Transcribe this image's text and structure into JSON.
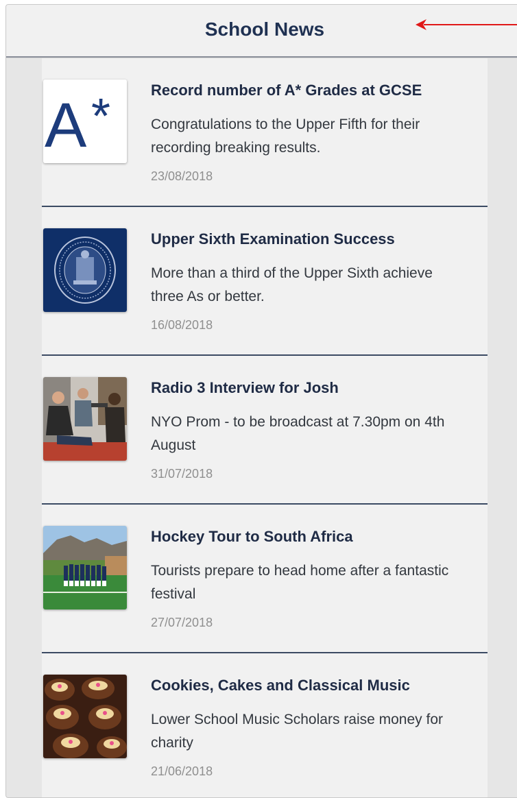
{
  "header": {
    "title": "School News"
  },
  "colors": {
    "navy": "#1f3152",
    "annotation_arrow": "#e01818"
  },
  "news": [
    {
      "icon": "a-star-grade-thumbnail",
      "title": "Record number of A* Grades at GCSE",
      "summary": "Congratulations to the Upper Fifth for their recording breaking results.",
      "date": "23/08/2018"
    },
    {
      "icon": "school-seal-thumbnail",
      "title": "Upper Sixth Examination Success",
      "summary": "More than a third of the Upper Sixth achieve three As or better.",
      "date": "16/08/2018"
    },
    {
      "icon": "radio-interview-photo",
      "title": "Radio 3 Interview for Josh",
      "summary": "NYO Prom - to be broadcast at 7.30pm on 4th August",
      "date": "31/07/2018"
    },
    {
      "icon": "hockey-team-photo",
      "title": "Hockey Tour to South Africa",
      "summary": "Tourists prepare to head home after a fantastic festival",
      "date": "27/07/2018"
    },
    {
      "icon": "cupcakes-photo",
      "title": "Cookies, Cakes and Classical Music",
      "summary": "Lower School Music Scholars raise money for charity",
      "date": "21/06/2018"
    }
  ]
}
